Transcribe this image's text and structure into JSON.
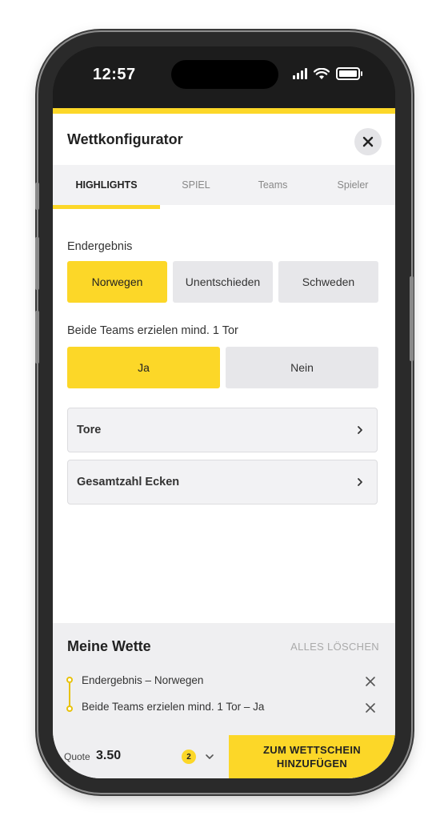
{
  "status_bar": {
    "time": "12:57"
  },
  "header": {
    "title": "Wettkonfigurator",
    "close_icon": "close-icon"
  },
  "tabs": [
    {
      "label": "HIGHLIGHTS",
      "active": true
    },
    {
      "label": "SPIEL",
      "active": false
    },
    {
      "label": "Teams",
      "active": false
    },
    {
      "label": "Spieler",
      "active": false
    }
  ],
  "markets": {
    "result": {
      "label": "Endergebnis",
      "options": [
        {
          "label": "Norwegen",
          "selected": true
        },
        {
          "label": "Unentschieden",
          "selected": false
        },
        {
          "label": "Schweden",
          "selected": false
        }
      ]
    },
    "btts": {
      "label": "Beide Teams erzielen mind. 1 Tor",
      "options": [
        {
          "label": "Ja",
          "selected": true
        },
        {
          "label": "Nein",
          "selected": false
        }
      ]
    },
    "collapsed": [
      {
        "label": "Tore"
      },
      {
        "label": "Gesamtzahl Ecken"
      }
    ]
  },
  "my_bet": {
    "title": "Meine Wette",
    "clear_all": "ALLES LÖSCHEN",
    "selections": [
      {
        "text": "Endergebnis – Norwegen"
      },
      {
        "text": "Beide Teams erzielen mind. 1 Tor – Ja"
      }
    ]
  },
  "bottom_bar": {
    "quote_label": "Quote",
    "quote_value": "3.50",
    "selection_count": "2",
    "cta_line1": "ZUM WETTSCHEIN",
    "cta_line2": "HINZUFÜGEN"
  },
  "colors": {
    "accent": "#fcd728",
    "panel": "#efeff1",
    "option": "#e7e7ea"
  }
}
